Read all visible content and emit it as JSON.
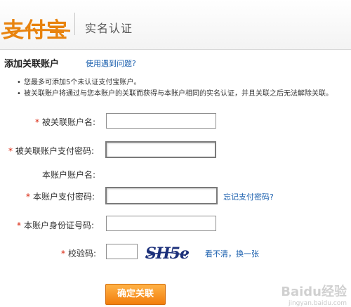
{
  "header": {
    "logo_text": "支付宝",
    "title": "实名认证"
  },
  "section": {
    "title": "添加关联账户",
    "help_link": "使用遇到问题?"
  },
  "notes": [
    "您最多可添加5个未认证支付宝账户。",
    "被关联账户将通过与您本账户的关联而获得与本账户相同的实名认证，并且关联之后无法解除关联。"
  ],
  "form": {
    "required_mark": "*",
    "linked_account_label": "被关联账户名:",
    "linked_password_label": "被关联账户支付密码:",
    "this_account_label": "本账户账户名:",
    "this_password_label": "本账户支付密码:",
    "forgot_password_link": "忘记支付密码?",
    "id_number_label": "本账户身份证号码:",
    "captcha_label": "校验码:",
    "captcha_text": "SH5e",
    "refresh_captcha_link": "看不清，换一张",
    "submit_label": "确定关联"
  },
  "watermark": {
    "main": "Baidu经验",
    "sub": "jingyan.baidu.com"
  }
}
